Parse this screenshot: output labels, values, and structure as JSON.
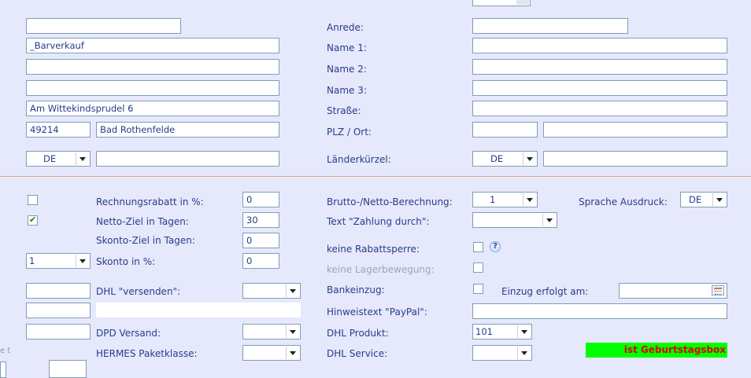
{
  "left": {
    "name_fields": [
      "",
      "_Barverkauf",
      "",
      ""
    ],
    "street": "Am Wittekindsprudel 6",
    "zip": "49214",
    "city": "Bad Rothenfelde",
    "country_code": "DE",
    "country_extra": ""
  },
  "right": {
    "labels": {
      "anrede": "Anrede:",
      "name1": "Name 1:",
      "name2": "Name 2:",
      "name3": "Name 3:",
      "strasse": "Straße:",
      "plz_ort": "PLZ / Ort:",
      "laenderkuerzel": "Länderkürzel:"
    },
    "values": {
      "anrede": "",
      "name1": "",
      "name2": "",
      "name3": "",
      "strasse": "",
      "plz": "",
      "ort": "",
      "country_code": "DE",
      "country_extra": ""
    }
  },
  "lower_left": {
    "rechnungsrabatt_label": "Rechnungsrabatt in %:",
    "rechnungsrabatt_value": "0",
    "netto_ziel_label": "Netto-Ziel in Tagen:",
    "netto_ziel_value": "30",
    "skonto_ziel_label": "Skonto-Ziel in Tagen:",
    "skonto_ziel_value": "0",
    "skonto_label": "Skonto in %:",
    "skonto_value": "0",
    "skonto_select": "1",
    "dhl_versenden_label": "DHL \"versenden\":",
    "dpd_label": "DPD Versand:",
    "hermes_label": "HERMES Paketklasse:",
    "partial_bottom_left": "e t"
  },
  "lower_right": {
    "brutto_netto_label": "Brutto-/Netto-Berechnung:",
    "brutto_netto_value": "1",
    "sprache_label": "Sprache Ausdruck:",
    "sprache_value": "DE",
    "zahlung_label": "Text \"Zahlung durch\":",
    "zahlung_value": "",
    "rabattsperre_label": "keine Rabattsperre:",
    "lagerbewegung_label": "keine Lagerbewegung:",
    "bankeinzug_label": "Bankeinzug:",
    "einzug_label": "Einzug erfolgt am:",
    "einzug_value": "",
    "paypal_label": "Hinweistext \"PayPal\":",
    "paypal_value": "",
    "dhl_produkt_label": "DHL Produkt:",
    "dhl_produkt_value": "101",
    "dhl_service_label": "DHL Service:",
    "geburtstagsbox": "ist Geburtstagsbox"
  },
  "colors": {
    "background": "#e6e9fb",
    "text": "#283c8c",
    "separator": "#e8a27a",
    "badge_bg": "#00ff00",
    "badge_text": "#e00000"
  }
}
